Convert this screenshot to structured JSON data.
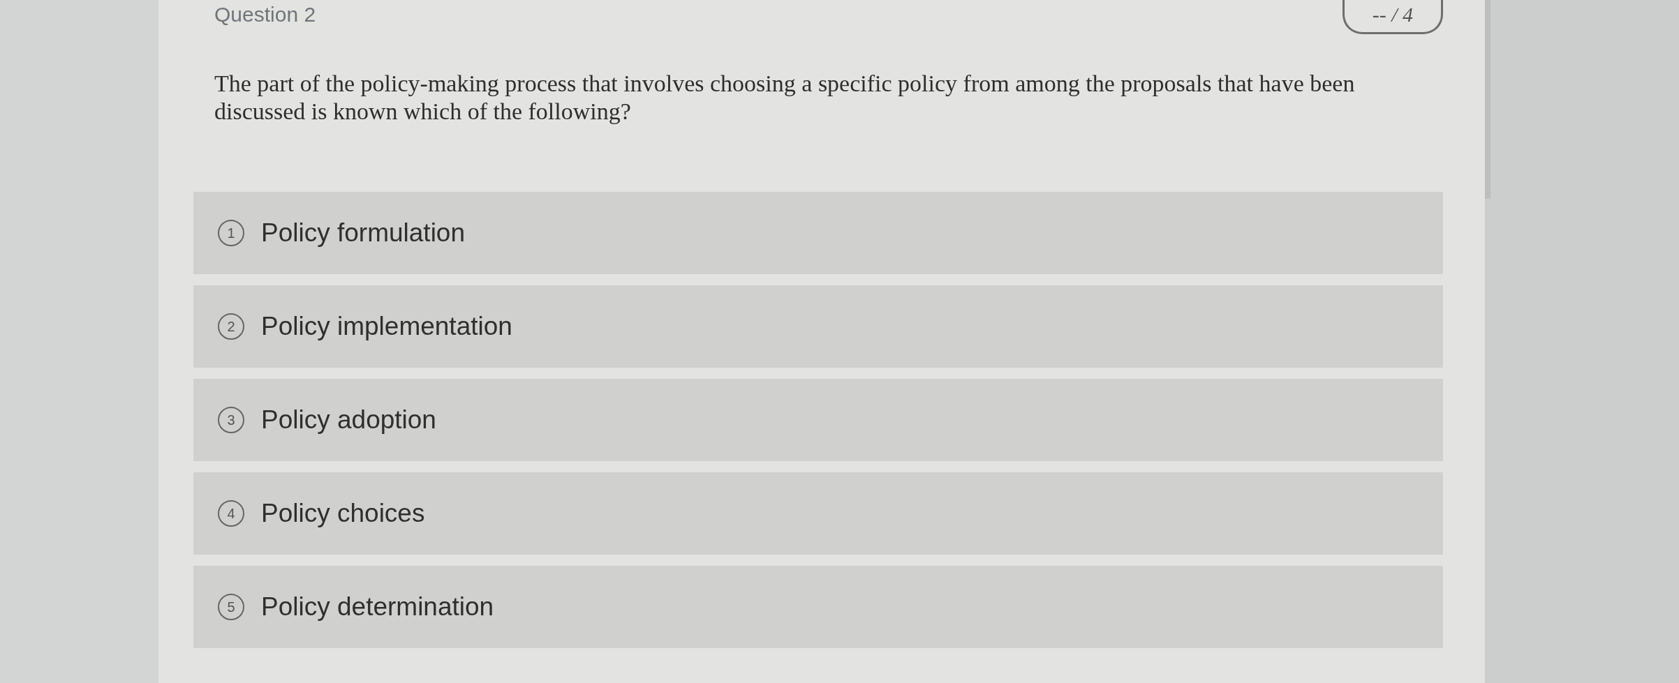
{
  "question": {
    "title": "Question 2",
    "points": "-- / 4",
    "text": "The part of the policy-making process that involves choosing a specific policy from among the proposals that have been discussed is known which of the following?"
  },
  "options": [
    {
      "number": "1",
      "label": "Policy formulation",
      "selected": false
    },
    {
      "number": "2",
      "label": "Policy implementation",
      "selected": false
    },
    {
      "number": "3",
      "label": "Policy adoption",
      "selected": false
    },
    {
      "number": "4",
      "label": "Policy choices",
      "selected": false
    },
    {
      "number": "5",
      "label": "Policy determination",
      "selected": false
    }
  ]
}
